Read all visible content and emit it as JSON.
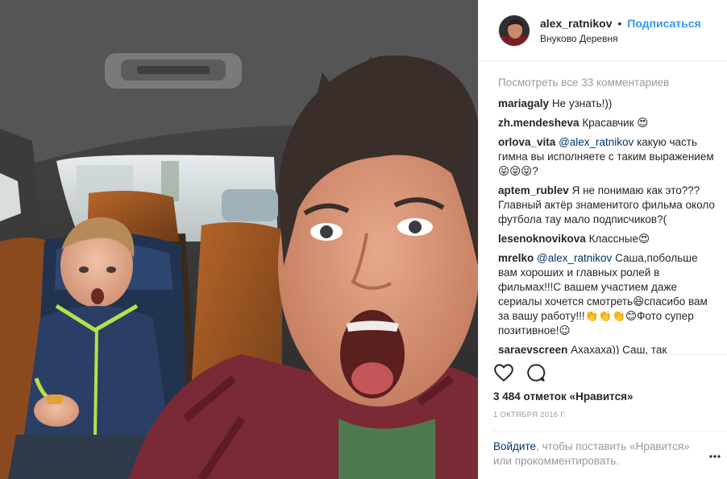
{
  "post": {
    "username": "alex_ratnikov",
    "separator": "•",
    "follow_label": "Подписаться",
    "location": "Внуково Деревня"
  },
  "comments": {
    "view_all_label": "Посмотреть все 33 комментариев",
    "items": [
      {
        "user": "mariagaly",
        "mention": "",
        "text": "Не узнать!))"
      },
      {
        "user": "zh.mendesheva",
        "mention": "",
        "text": "Красавчик 😍"
      },
      {
        "user": "orlova_vita",
        "mention": "@alex_ratnikov",
        "text": "какую часть гимна вы исполняете с таким выражением 😝😝😝?"
      },
      {
        "user": "aptem_rublev",
        "mention": "",
        "text": "Я не понимаю как это??? Главный актёр знаменитого фильма около футбола тау мало подписчиков?("
      },
      {
        "user": "lesenoknovikova",
        "mention": "",
        "text": "Классные😍"
      },
      {
        "user": "mrelko",
        "mention": "@alex_ratnikov",
        "text": "Саша,побольше вам хороших и главных ролей в фильмах!!!С вашем участием даже сериалы хочется смотреть😆спасибо вам за вашу работу!!!👏👏👏😊Фото супер позитивное!😉"
      },
      {
        "user": "saraevscreen",
        "mention": "",
        "text": "Ахахаха)) Саш, так держать))"
      }
    ]
  },
  "actions": {
    "like_icon": "heart-icon",
    "comment_icon": "comment-icon"
  },
  "likes_label": "3 484 отметок «Нравится»",
  "date_label": "1 ОКТЯБРЯ 2016 Г.",
  "login_prompt": {
    "link": "Войдите",
    "rest": ", чтобы поставить «Нравится» или прокомментировать."
  },
  "colors": {
    "accent": "#3897f0",
    "link": "#003569",
    "muted": "#999999",
    "text": "#262626"
  }
}
